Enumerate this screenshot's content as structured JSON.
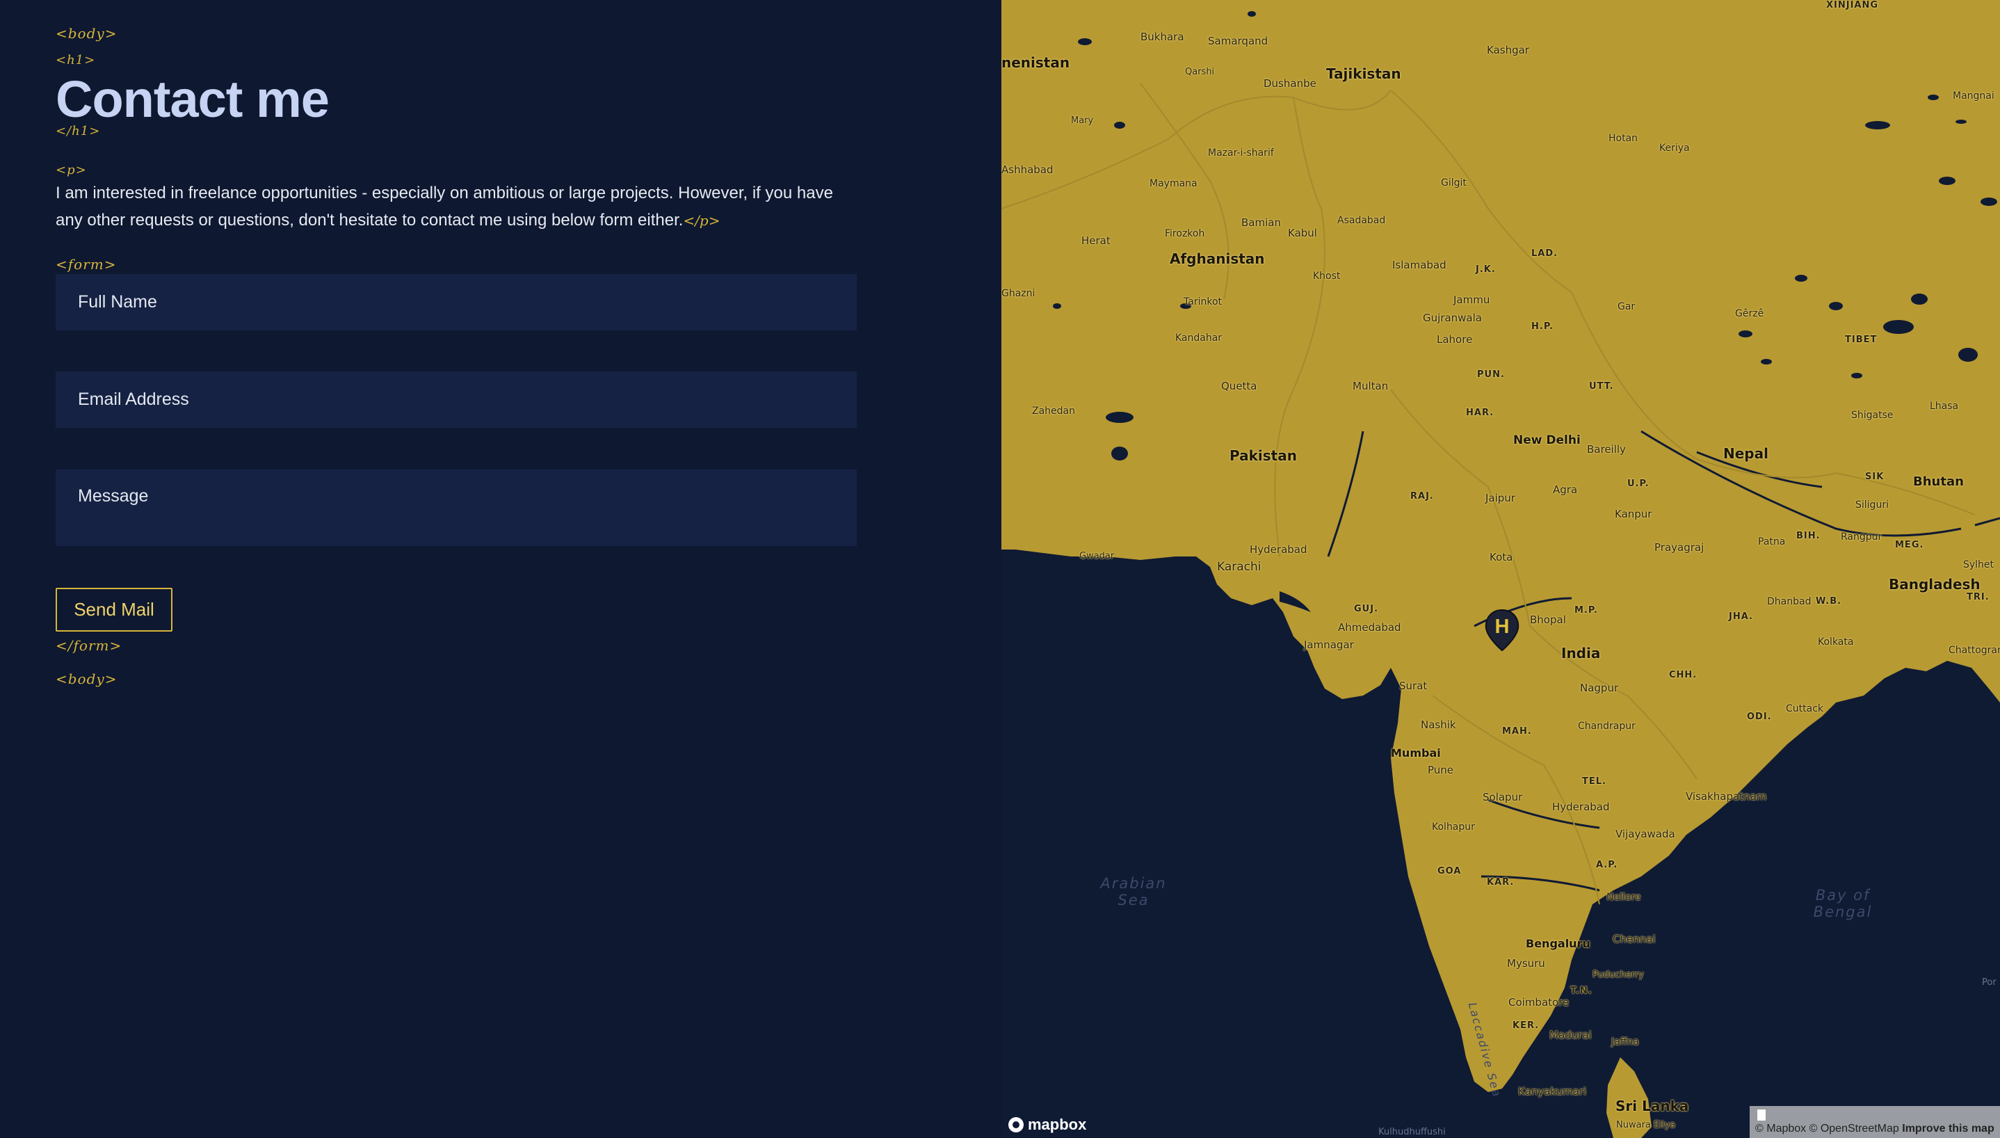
{
  "tags": {
    "body_open": "<body>",
    "h1_open": "<h1>",
    "h1_close": "</h1>",
    "p_open": "<p>",
    "p_close": "</p>",
    "form_open": "<form>",
    "form_close": "</form>",
    "body_close": "<body>"
  },
  "heading": "Contact me",
  "intro": "I am interested in freelance opportunities - especially on ambitious or large projects. However, if you have any other requests or questions, don't hesitate to contact me using below form either.",
  "form": {
    "name_placeholder": "Full Name",
    "email_placeholder": "Email Address",
    "message_placeholder": "Message",
    "send_label": "Send Mail"
  },
  "map": {
    "labels": {
      "tajikistan": "Tajikistan",
      "afghanistan": "Afghanistan",
      "pakistan": "Pakistan",
      "india": "India",
      "nepal": "Nepal",
      "bhutan": "Bhutan",
      "bangladesh": "Bangladesh",
      "sri_lanka": "Sri Lanka",
      "turkmenistan": "nenistan",
      "new_delhi": "New Delhi",
      "mumbai": "Mumbai",
      "bengaluru": "Bengaluru",
      "karachi": "Karachi",
      "kabul": "Kabul",
      "dushanbe": "Dushanbe",
      "bukhara": "Bukhara",
      "samarqand": "Samarqand",
      "kashgar": "Kashgar",
      "qarshi": "Qarshi",
      "mary": "Mary",
      "ashhabad": "Ashhabad",
      "mazar": "Mazar-i-sharif",
      "maymana": "Maymana",
      "herat": "Herat",
      "bamian": "Bamian",
      "firozkoh": "Firozkoh",
      "asadabad": "Asadabad",
      "gilgit": "Gilgit",
      "hotan": "Hotan",
      "keriya": "Keriya",
      "islamabad": "Islamabad",
      "jk": "J.K.",
      "lad": "LAD.",
      "khost": "Khost",
      "tarinkot": "Tarinkot",
      "kandahar": "Kandahar",
      "jammu": "Jammu",
      "gujranwala": "Gujranwala",
      "lahore": "Lahore",
      "hp": "H.P.",
      "gar": "Gar",
      "gerze": "Gêrzê",
      "tibet": "TIBET",
      "quetta": "Quetta",
      "multan": "Multan",
      "pun": "PUN.",
      "utt": "UTT.",
      "zahedan": "Zahedan",
      "har": "HAR.",
      "shigatse": "Shigatse",
      "lhasa": "Lhasa",
      "bareilly": "Bareilly",
      "raj": "RAJ.",
      "jaipur": "Jaipur",
      "agra": "Agra",
      "up": "U.P.",
      "sik": "SIK",
      "siliguri": "Siliguri",
      "kanpur": "Kanpur",
      "gwadar": "Gwadar",
      "hyderabad_pk": "Hyderabad",
      "prayagraj": "Prayagraj",
      "patna": "Patna",
      "bih": "BIH.",
      "rangpur": "Rangpur",
      "meg": "MEG.",
      "sylhet": "Sylhet",
      "tri": "TRI.",
      "kota": "Kota",
      "guj": "GUJ.",
      "bhopal": "Bhopal",
      "mp": "M.P.",
      "ahmedabad": "Ahmedabad",
      "jha": "JHA.",
      "dhanbad": "Dhanbad",
      "wb": "W.B.",
      "kolkata": "Kolkata",
      "chattogram": "Chattogram",
      "jamnagar": "Jamnagar",
      "surat": "Surat",
      "chh": "CHH.",
      "nagpur": "Nagpur",
      "cuttack": "Cuttack",
      "odi": "ODI.",
      "nashik": "Nashik",
      "mah": "MAH.",
      "chandrapur": "Chandrapur",
      "pune": "Pune",
      "tel": "TEL.",
      "solapur": "Solapur",
      "hyderabad_in": "Hyderabad",
      "visakhapatnam": "Visakhapatnam",
      "kolhapur": "Kolhapur",
      "vijayawada": "Vijayawada",
      "goa": "GOA",
      "ap": "A.P.",
      "kar": "KAR.",
      "nellore": "Nellore",
      "chennai": "Chennai",
      "mysuru": "Mysuru",
      "puducherry": "Puducherry",
      "tn": "T.N.",
      "coimbatore": "Coimbatore",
      "ker": "KER.",
      "madurai": "Madurai",
      "jaffna": "Jaffna",
      "kanyakumari": "Kanyakumari",
      "nuwara_eliya": "Nuwara Eliya",
      "kulhudhuffushi": "Kulhudhuffushi",
      "xinjiang": "XINJIANG",
      "mangnai": "Mangnai",
      "ghazni": "Ghazni",
      "por": "Por",
      "arabian_sea": "Arabian Sea",
      "bay_of_bengal": "Bay of Bengal",
      "lakshadweep_sea": "Laccadive Sea"
    },
    "marker_letter": "H",
    "logo": "mapbox",
    "attribution": "© Mapbox © OpenStreetMap",
    "improve": "Improve this map",
    "land_color": "#b89a33",
    "water_color": "#0f1a33"
  }
}
